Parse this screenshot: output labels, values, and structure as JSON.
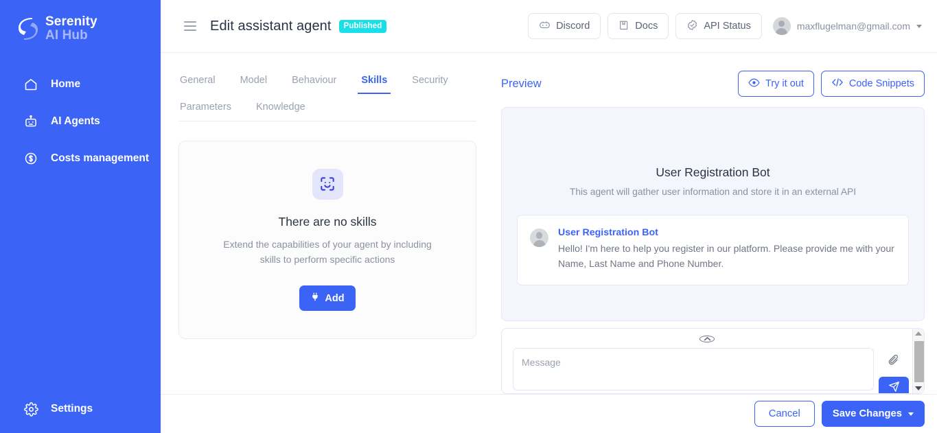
{
  "sidebar": {
    "logo": {
      "line1": "Serenity",
      "line2": "AI Hub",
      "icon": "serenity-s-logo"
    },
    "items": [
      {
        "label": "Home",
        "icon": "home-icon"
      },
      {
        "label": "AI Agents",
        "icon": "robot-icon"
      },
      {
        "label": "Costs management",
        "icon": "dollar-circle-icon"
      }
    ],
    "bottom": {
      "label": "Settings",
      "icon": "gear-icon"
    }
  },
  "topbar": {
    "menu_icon": "hamburger-icon",
    "title": "Edit assistant agent",
    "status_badge": "Published",
    "buttons": [
      {
        "label": "Discord",
        "icon": "discord-icon"
      },
      {
        "label": "Docs",
        "icon": "book-icon"
      },
      {
        "label": "API Status",
        "icon": "badge-check-icon"
      }
    ],
    "user": {
      "email": "maxflugelman@gmail.com",
      "avatar": "user-avatar",
      "caret": "chevron-down-icon"
    }
  },
  "tabs": [
    {
      "label": "General",
      "active": false
    },
    {
      "label": "Model",
      "active": false
    },
    {
      "label": "Behaviour",
      "active": false
    },
    {
      "label": "Skills",
      "active": true
    },
    {
      "label": "Security",
      "active": false
    },
    {
      "label": "Parameters",
      "active": false
    },
    {
      "label": "Knowledge",
      "active": false
    }
  ],
  "skills_empty_state": {
    "icon": "face-scan-icon",
    "title": "There are no skills",
    "subtitle": "Extend the capabilities of your agent by including skills to perform specific actions",
    "add_label": "Add",
    "add_icon": "plug-icon"
  },
  "preview": {
    "label": "Preview",
    "actions": [
      {
        "label": "Try it out",
        "icon": "eye-icon"
      },
      {
        "label": "Code Snippets",
        "icon": "code-brackets-icon"
      }
    ],
    "bot_name": "User Registration Bot",
    "bot_description": "This agent will gather user information and store it in an external API",
    "message": {
      "author": "User Registration Bot",
      "text": "Hello! I'm here to help you register in our platform. Please provide me with your Name, Last Name and Phone Number.",
      "avatar": "bot-avatar"
    }
  },
  "composer": {
    "collapse_icon": "chevron-up-circle-icon",
    "placeholder": "Message",
    "value": "",
    "attach_icon": "paperclip-icon",
    "send_icon": "send-plane-icon",
    "scrollbar": {
      "up": "scroll-up-arrow",
      "down": "scroll-down-arrow"
    }
  },
  "footer": {
    "cancel_label": "Cancel",
    "save_label": "Save Changes",
    "save_caret": "chevron-down-icon"
  },
  "colors": {
    "brand_blue": "#3b63f6",
    "badge_cyan": "#18dfe8",
    "preview_bg": "#f3f6fd",
    "icon_box_bg": "#e3e6fb",
    "muted_text": "#8a91a0"
  }
}
